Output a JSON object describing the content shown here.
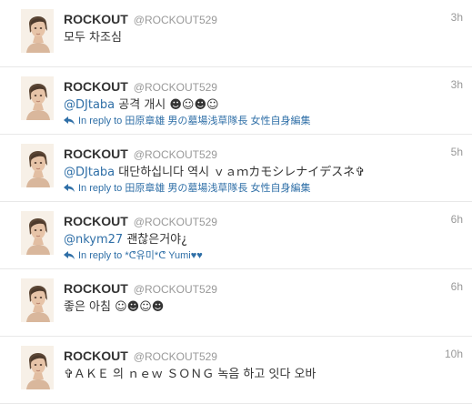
{
  "tweets": [
    {
      "name": "ROCKOUT",
      "handle": "@ROCKOUT529",
      "time": "3h",
      "mention": "",
      "text": "모두 차조심",
      "reply_prefix": "",
      "reply_to": ""
    },
    {
      "name": "ROCKOUT",
      "handle": "@ROCKOUT529",
      "time": "3h",
      "mention": "@DJtaba",
      "text": " 공격 개시 ☻☺☻☺",
      "reply_prefix": "In reply to",
      "reply_to": "田原章雄 男の墓場浅草隊長 女性自身編集"
    },
    {
      "name": "ROCKOUT",
      "handle": "@ROCKOUT529",
      "time": "5h",
      "mention": "@DJtaba",
      "text": " 대단하십니다 역시 ｖａｍカモシレナイデスネ✞",
      "reply_prefix": "In reply to",
      "reply_to": "田原章雄 男の墓場浅草隊長 女性自身編集"
    },
    {
      "name": "ROCKOUT",
      "handle": "@ROCKOUT529",
      "time": "6h",
      "mention": "@nkym27",
      "text": " 괜찮은거야¿",
      "reply_prefix": "In reply to",
      "reply_to": "*ᕦ유미*ᕦ Yumi♥♥"
    },
    {
      "name": "ROCKOUT",
      "handle": "@ROCKOUT529",
      "time": "6h",
      "mention": "",
      "text": "좋은 아침 ☺☻☺☻",
      "reply_prefix": "",
      "reply_to": ""
    },
    {
      "name": "ROCKOUT",
      "handle": "@ROCKOUT529",
      "time": "10h",
      "mention": "",
      "text": "✞ＡＫＥ 의 ｎｅｗ ＳＯＮＧ 녹음 하고 잇다 오바",
      "reply_prefix": "",
      "reply_to": ""
    }
  ],
  "icons": {
    "reply": "reply-arrow-icon",
    "avatar": "avatar"
  },
  "colors": {
    "link": "#2f6fa7",
    "meta": "#999999",
    "text": "#333333"
  }
}
